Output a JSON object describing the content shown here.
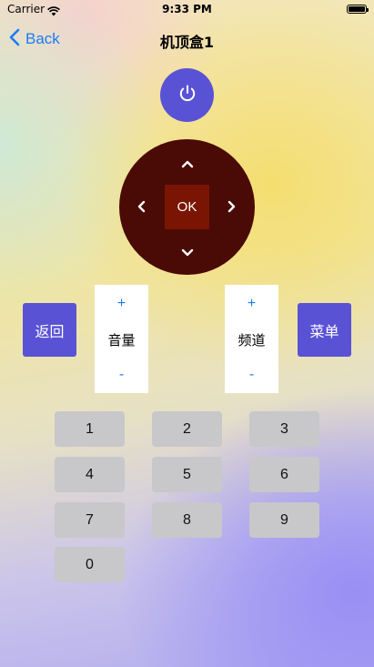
{
  "status_bar": {
    "carrier": "Carrier",
    "time": "9:33 PM",
    "icons": [
      "wifi-icon",
      "battery-icon"
    ]
  },
  "nav": {
    "back_label": "Back",
    "back_icon": "chevron-left-icon",
    "title": "机顶盒1"
  },
  "power": {
    "icon": "power-icon"
  },
  "dpad": {
    "ok_label": "OK",
    "icons": [
      "chevron-up-icon",
      "chevron-down-icon",
      "chevron-left-icon",
      "chevron-right-icon"
    ]
  },
  "actions": {
    "back_label": "返回",
    "menu_label": "菜单"
  },
  "volume": {
    "plus": "+",
    "label": "音量",
    "minus": "-"
  },
  "channel": {
    "plus": "+",
    "label": "频道",
    "minus": "-"
  },
  "keypad": {
    "keys": [
      "1",
      "2",
      "3",
      "4",
      "5",
      "6",
      "7",
      "8",
      "9",
      "0"
    ]
  },
  "colors": {
    "accent": "#5a52d5",
    "link": "#1a7cf5",
    "dpad": "#4a0a05",
    "ok": "#7a1504",
    "key": "#c8c7ca"
  }
}
